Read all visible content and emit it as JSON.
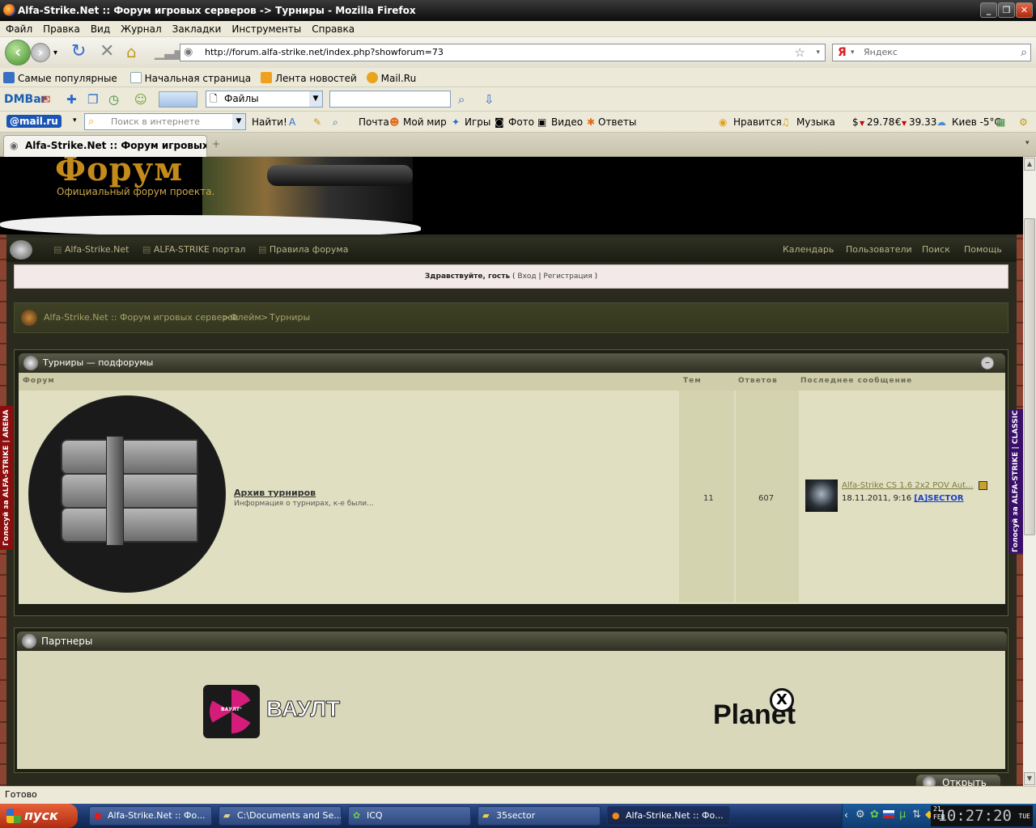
{
  "window": {
    "title": "Alfa-Strike.Net :: Форум игровых серверов -> Турниры - Mozilla Firefox"
  },
  "menu": [
    "Файл",
    "Правка",
    "Вид",
    "Журнал",
    "Закладки",
    "Инструменты",
    "Справка"
  ],
  "nav": {
    "url": "http://forum.alfa-strike.net/index.php?showforum=73",
    "search_placeholder": "Яндекс"
  },
  "bookmarks": [
    "Самые популярные",
    "Начальная страница",
    "Лента новостей",
    "Mail.Ru"
  ],
  "dmbar": {
    "label": "DMBar",
    "select_value": "Файлы"
  },
  "mailbar": {
    "brand": "@mail.ru",
    "search_placeholder": "Поиск в интернете",
    "search_button": "Найти!",
    "links": [
      "Почта",
      "Мой мир",
      "Игры",
      "Фото",
      "Видео",
      "Ответы"
    ],
    "like": "Нравится",
    "music": "Музыка",
    "usd": "29.78",
    "eur": "39.33",
    "weather": "Киев -5°C"
  },
  "tab": {
    "title": "Alfa-Strike.Net :: Форум игровых се..."
  },
  "site": {
    "logo": "Форум",
    "logo_sub": "Официальный форум проекта.",
    "topnav_left": [
      "Alfa-Strike.Net",
      "ALFA-STRIKE портал",
      "Правила форума"
    ],
    "topnav_right": [
      "Календарь",
      "Пользователи",
      "Поиск",
      "Помощь"
    ],
    "greeting": "Здравствуйте, гость",
    "login": "Вход",
    "register": "Регистрация",
    "breadcrumb": [
      "Alfa-Strike.Net :: Форум игровых серверов",
      "Флейм",
      "Турниры"
    ],
    "side_left": "Голосуй за ALFA-STRIKE | ARENA",
    "side_right": "Голосуй за ALFA-STRIKE | CLASSIC"
  },
  "subforums": {
    "title": "Турниры — подфорумы",
    "columns": [
      "Форум",
      "Тем",
      "Ответов",
      "Последнее сообщение"
    ],
    "rows": [
      {
        "name": "Архив турниров",
        "description": "Информация о турнирах, к-е были...",
        "topics": "11",
        "replies": "607",
        "last_title": "Alfa-Strike CS 1.6 2x2 POV Aut...",
        "last_date": "18.11.2011, 9:16",
        "last_author": "[A]SECTOR"
      }
    ]
  },
  "partners": {
    "title": "Партнеры",
    "vault": "ВАУЛТ",
    "vault_small": "ВАУЛТ°",
    "planet": "Planet",
    "planet_x": "X",
    "open": "Открыть"
  },
  "status": "Готово",
  "taskbar": {
    "start": "пуск",
    "tasks": [
      "Alfa-Strike.Net :: Фо...",
      "C:\\Documents and Se...",
      "ICQ",
      "35sector",
      "Alfa-Strike.Net :: Фо..."
    ],
    "clock": "10:27:20",
    "date_day": "21",
    "date_month": "FEB",
    "weekday": "TUE"
  },
  "colors": {
    "accent": "#3f8e2a",
    "forum_bg": "#2a2b1e",
    "link_blue": "#1a3fc9"
  }
}
